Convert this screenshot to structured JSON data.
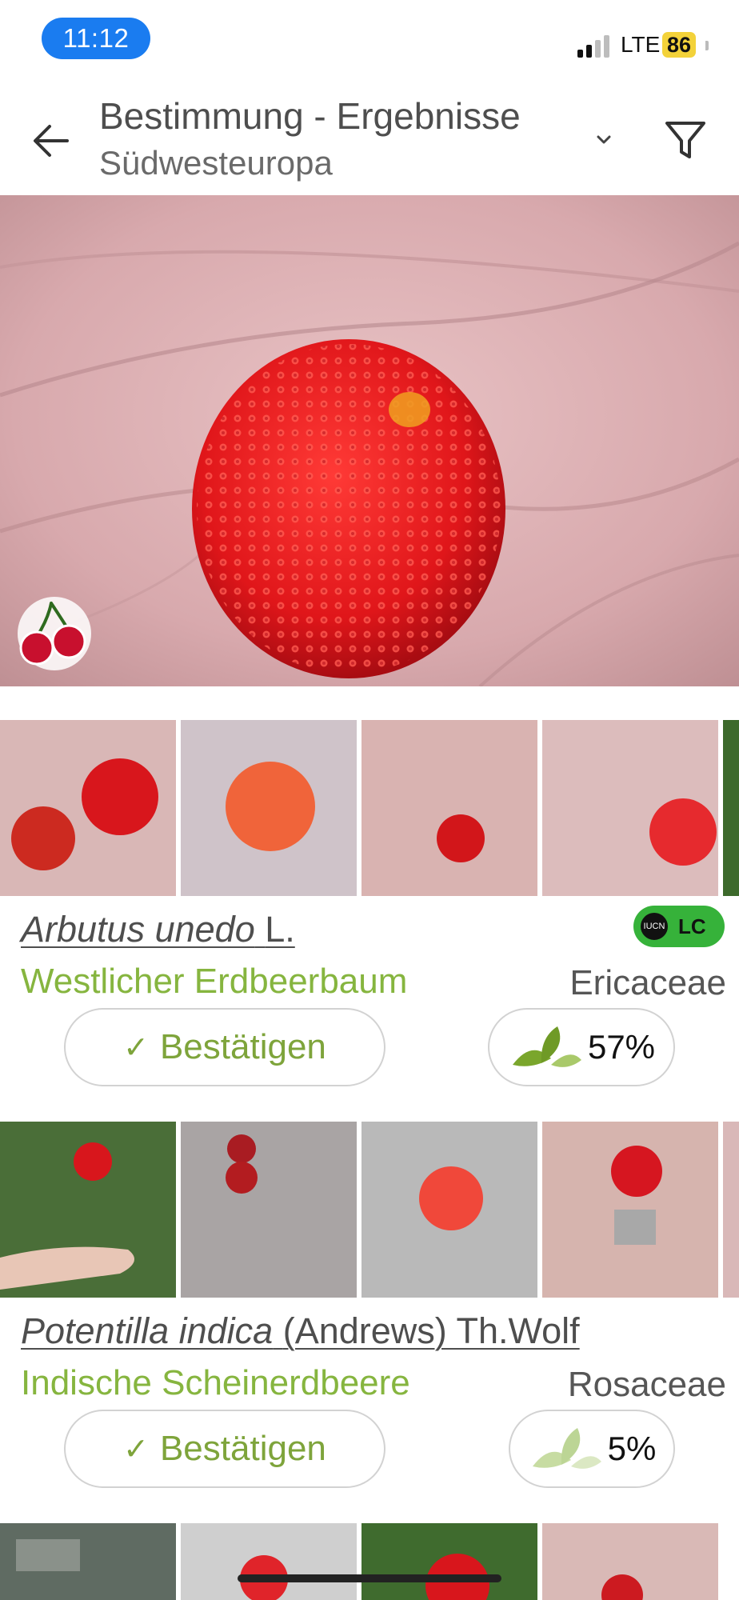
{
  "status": {
    "time": "11:12",
    "network": "LTE",
    "battery": "86"
  },
  "header": {
    "title": "Bestimmung - Ergebnisse",
    "subtitle": "Südwesteuropa"
  },
  "results": [
    {
      "genus_species": "Arbutus unedo",
      "author": "L.",
      "common_name": "Westlicher Erdbeerbaum",
      "family": "Ericaceae",
      "confirm_label": "Bestätigen",
      "score": "57%",
      "iucn": "LC"
    },
    {
      "genus_species": "Potentilla indica",
      "author": "(Andrews) Th.Wolf",
      "common_name": "Indische Scheinerdbeere",
      "family": "Rosaceae",
      "confirm_label": "Bestätigen",
      "score": "5%"
    }
  ],
  "colors": {
    "accent_green": "#86b53f",
    "status_pill": "#1a7cf0",
    "iucn_lc": "#36b23a",
    "battery": "#f3d23a"
  },
  "icons": [
    "back-arrow-icon",
    "chevron-down-icon",
    "filter-icon",
    "cherry-icon",
    "check-icon",
    "leaf-score-icon",
    "iucn-icon"
  ]
}
